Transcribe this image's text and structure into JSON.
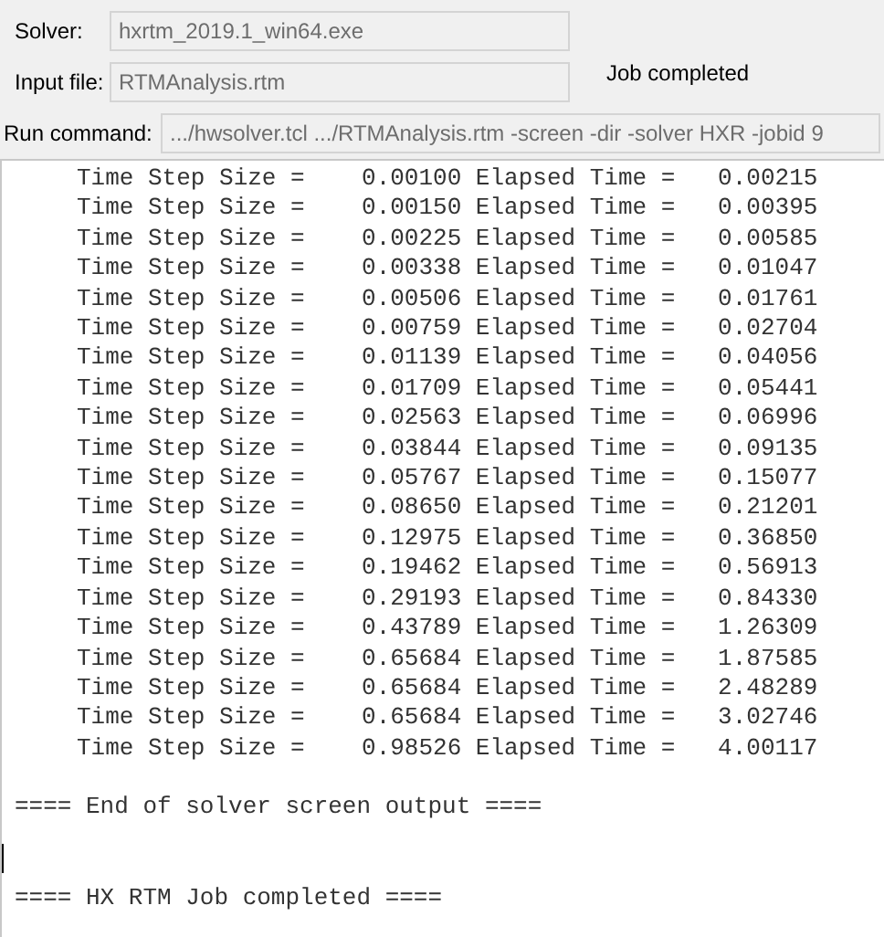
{
  "solver": {
    "label": "Solver:",
    "value": "hxrtm_2019.1_win64.exe"
  },
  "input_file": {
    "label": "Input file:",
    "value": "RTMAnalysis.rtm"
  },
  "status": "Job completed",
  "run_command": {
    "label": "Run command:",
    "value": ".../hwsolver.tcl .../RTMAnalysis.rtm -screen -dir -solver HXR -jobid 9"
  },
  "output": {
    "lines": [
      "Time Step Size =    0.00100 Elapsed Time =   0.00215",
      "Time Step Size =    0.00150 Elapsed Time =   0.00395",
      "Time Step Size =    0.00225 Elapsed Time =   0.00585",
      "Time Step Size =    0.00338 Elapsed Time =   0.01047",
      "Time Step Size =    0.00506 Elapsed Time =   0.01761",
      "Time Step Size =    0.00759 Elapsed Time =   0.02704",
      "Time Step Size =    0.01139 Elapsed Time =   0.04056",
      "Time Step Size =    0.01709 Elapsed Time =   0.05441",
      "Time Step Size =    0.02563 Elapsed Time =   0.06996",
      "Time Step Size =    0.03844 Elapsed Time =   0.09135",
      "Time Step Size =    0.05767 Elapsed Time =   0.15077",
      "Time Step Size =    0.08650 Elapsed Time =   0.21201",
      "Time Step Size =    0.12975 Elapsed Time =   0.36850",
      "Time Step Size =    0.19462 Elapsed Time =   0.56913",
      "Time Step Size =    0.29193 Elapsed Time =   0.84330",
      "Time Step Size =    0.43789 Elapsed Time =   1.26309",
      "Time Step Size =    0.65684 Elapsed Time =   1.87585",
      "Time Step Size =    0.65684 Elapsed Time =   2.48289",
      "Time Step Size =    0.65684 Elapsed Time =   3.02746",
      "Time Step Size =    0.98526 Elapsed Time =   4.00117"
    ],
    "end_marker": "==== End of solver screen output ====",
    "job_marker": "==== HX RTM Job completed ===="
  }
}
